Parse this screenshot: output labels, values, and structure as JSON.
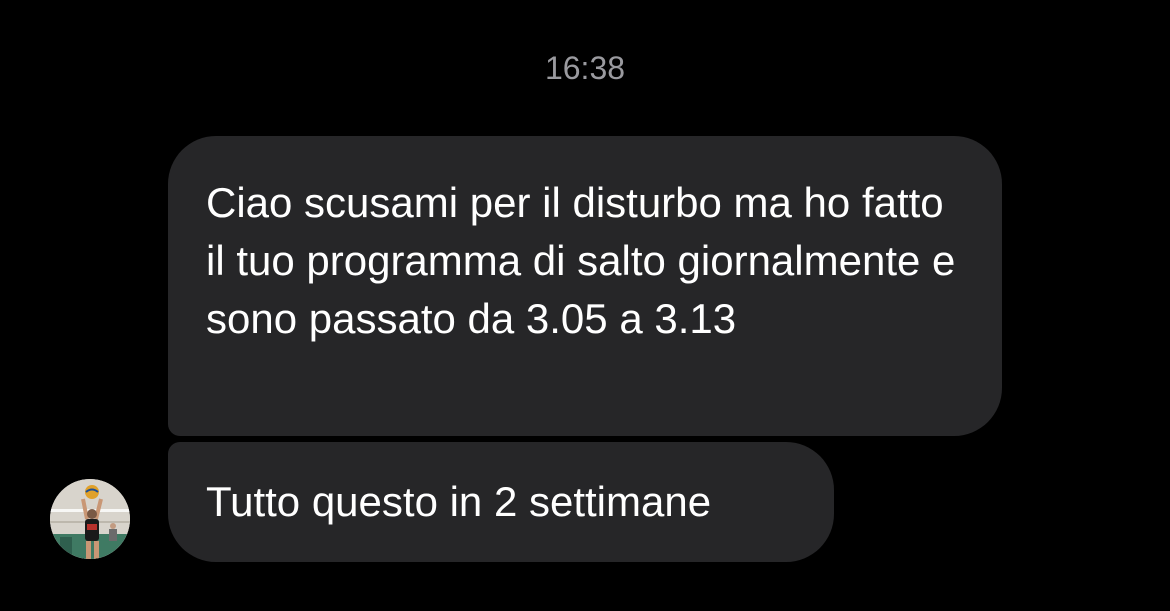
{
  "conversation": {
    "timestamp": "16:38",
    "messages": [
      {
        "text": "Ciao scusami per il disturbo ma ho fatto il tuo programma di salto giornalmente e sono passato da 3.05 a 3.13"
      },
      {
        "text": "Tutto questo in 2 settimane"
      }
    ],
    "sender_avatar": {
      "icon": "volleyball-player-photo"
    }
  },
  "colors": {
    "background": "#000000",
    "bubble": "#262628",
    "text": "#ffffff",
    "timestamp": "#9a9a9f"
  }
}
